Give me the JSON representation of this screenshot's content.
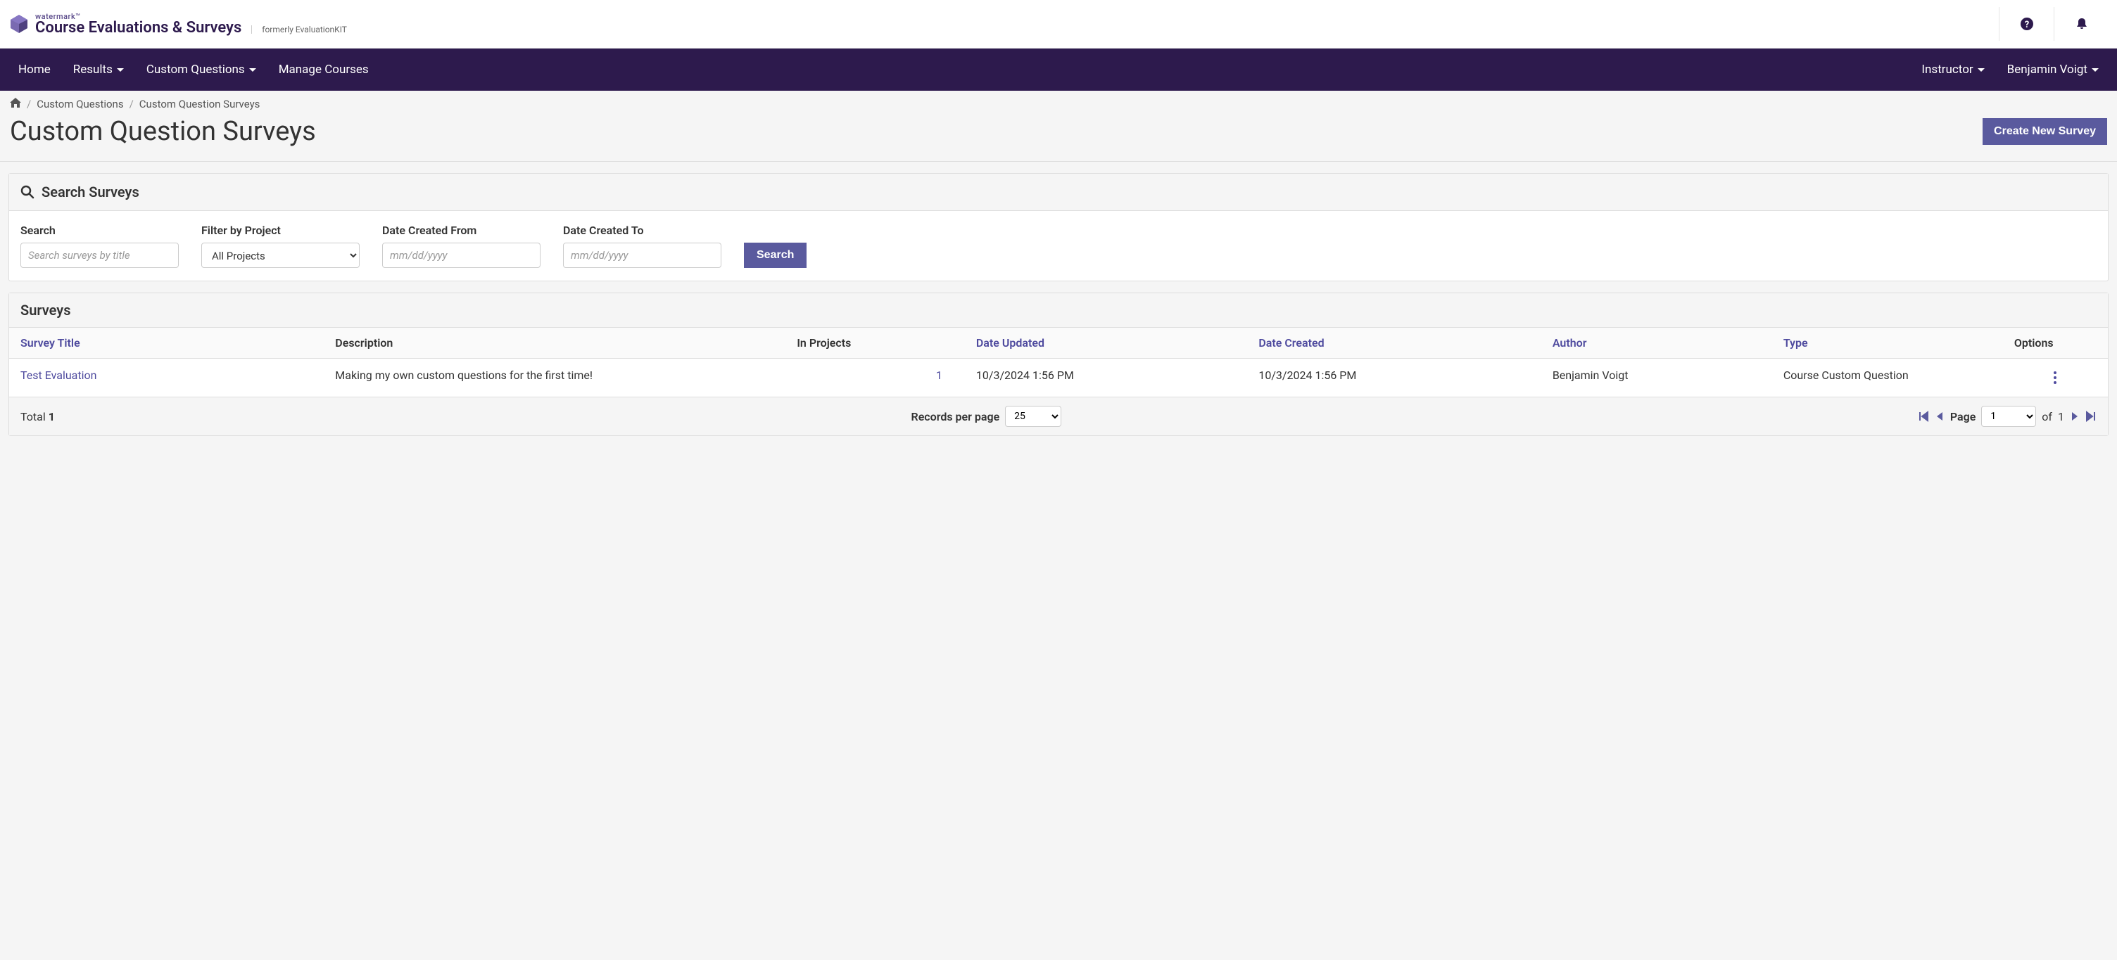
{
  "brand": {
    "watermark": "watermark™",
    "product": "Course Evaluations & Surveys",
    "formerly": "formerly EvaluationKIT"
  },
  "nav": {
    "home": "Home",
    "results": "Results",
    "custom_questions": "Custom Questions",
    "manage_courses": "Manage Courses",
    "role": "Instructor",
    "user": "Benjamin Voigt"
  },
  "breadcrumb": {
    "item1": "Custom Questions",
    "item2": "Custom Question Surveys"
  },
  "page": {
    "title": "Custom Question Surveys",
    "create_btn": "Create New Survey"
  },
  "search_panel": {
    "title": "Search Surveys",
    "search_label": "Search",
    "search_placeholder": "Search surveys by title",
    "filter_label": "Filter by Project",
    "filter_value": "All Projects",
    "date_from_label": "Date Created From",
    "date_to_label": "Date Created To",
    "date_placeholder": "mm/dd/yyyy",
    "search_btn": "Search"
  },
  "surveys_panel": {
    "title": "Surveys",
    "cols": {
      "title": "Survey Title",
      "description": "Description",
      "in_projects": "In Projects",
      "date_updated": "Date Updated",
      "date_created": "Date Created",
      "author": "Author",
      "type": "Type",
      "options": "Options"
    },
    "rows": [
      {
        "title": "Test Evaluation",
        "description": "Making my own custom questions for the first time!",
        "in_projects": "1",
        "date_updated": "10/3/2024 1:56 PM",
        "date_created": "10/3/2024 1:56 PM",
        "author": "Benjamin Voigt",
        "type": "Course Custom Question"
      }
    ],
    "footer": {
      "total_label": "Total",
      "total_count": "1",
      "records_label": "Records per page",
      "records_value": "25",
      "page_label": "Page",
      "page_value": "1",
      "of_label": "of",
      "total_pages": "1"
    }
  }
}
